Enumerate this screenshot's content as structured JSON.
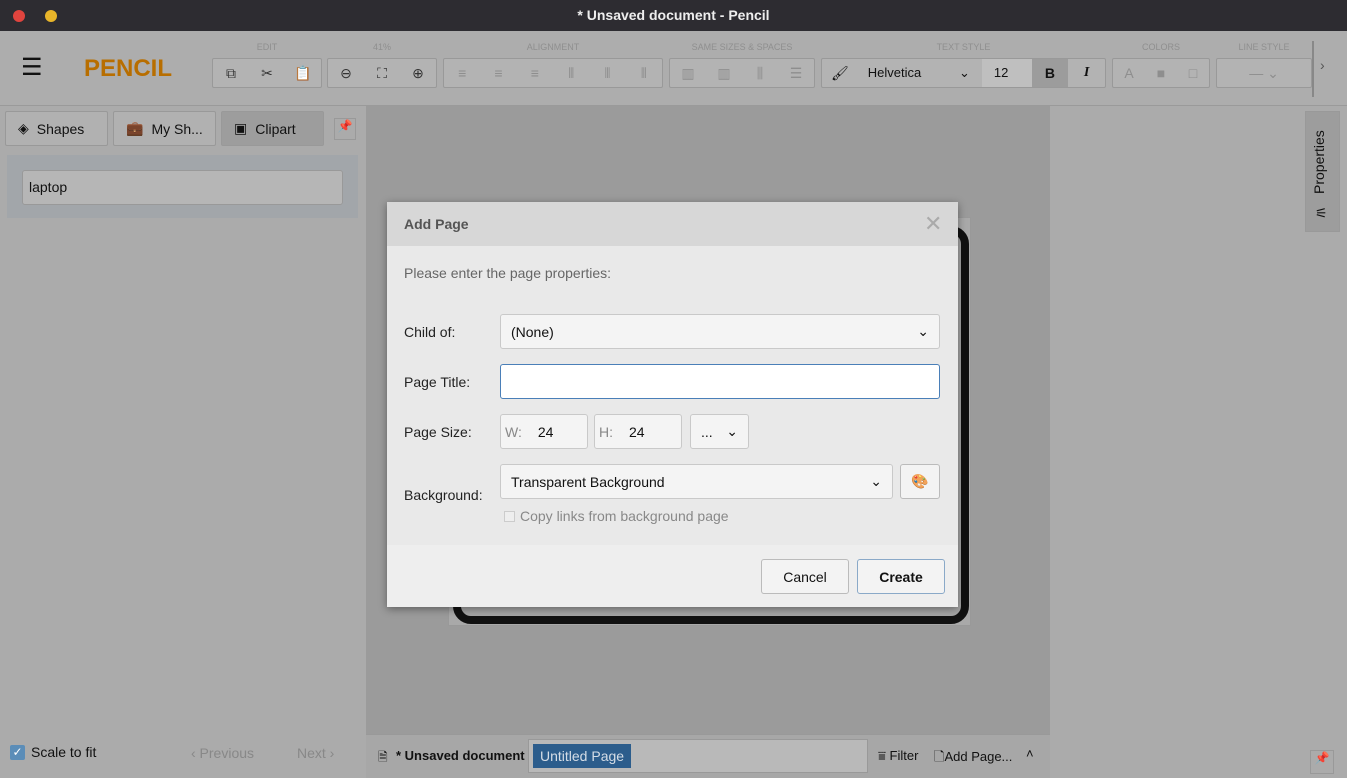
{
  "window": {
    "title": "* Unsaved document - Pencil"
  },
  "app": {
    "logo": "PENCIL",
    "brand_color": "#b86e00"
  },
  "toolbar": {
    "groups": {
      "edit": "EDIT",
      "zoom": "41%",
      "alignment": "ALIGNMENT",
      "same_sizes": "SAME SIZES & SPACES",
      "text_style": "TEXT STYLE",
      "colors": "COLORS",
      "line_style": "LINE STYLE"
    },
    "font_family": "Helvetica",
    "font_size": "12",
    "bold": "B",
    "italic": "I",
    "color_text": "A"
  },
  "left_panel": {
    "tabs": [
      {
        "label": "Shapes",
        "icon": "layers-icon"
      },
      {
        "label": "My Sh...",
        "icon": "briefcase-icon"
      },
      {
        "label": "Clipart",
        "icon": "image-icon",
        "active": true
      }
    ],
    "search_value": "laptop",
    "scale_to_fit": {
      "label": "Scale to fit",
      "checked": true
    },
    "previous": "‹ Previous",
    "next": "Next ›"
  },
  "right_panel": {
    "properties_label": "Properties"
  },
  "bottom": {
    "document": "* Unsaved document",
    "page_tab": "Untitled Page",
    "filter": "Filter",
    "add_page": "Add Page..."
  },
  "dialog": {
    "title": "Add Page",
    "prompt": "Please enter the page properties:",
    "child_of_label": "Child of:",
    "child_of_value": "(None)",
    "page_title_label": "Page Title:",
    "page_title_value": "",
    "page_size_label": "Page Size:",
    "w_label": "W:",
    "w_value": "24",
    "h_label": "H:",
    "h_value": "24",
    "size_preset": "...",
    "background_label": "Background:",
    "background_value": "Transparent Background",
    "copy_links_label": "Copy links from background page",
    "copy_links_checked": false,
    "cancel": "Cancel",
    "create": "Create"
  }
}
